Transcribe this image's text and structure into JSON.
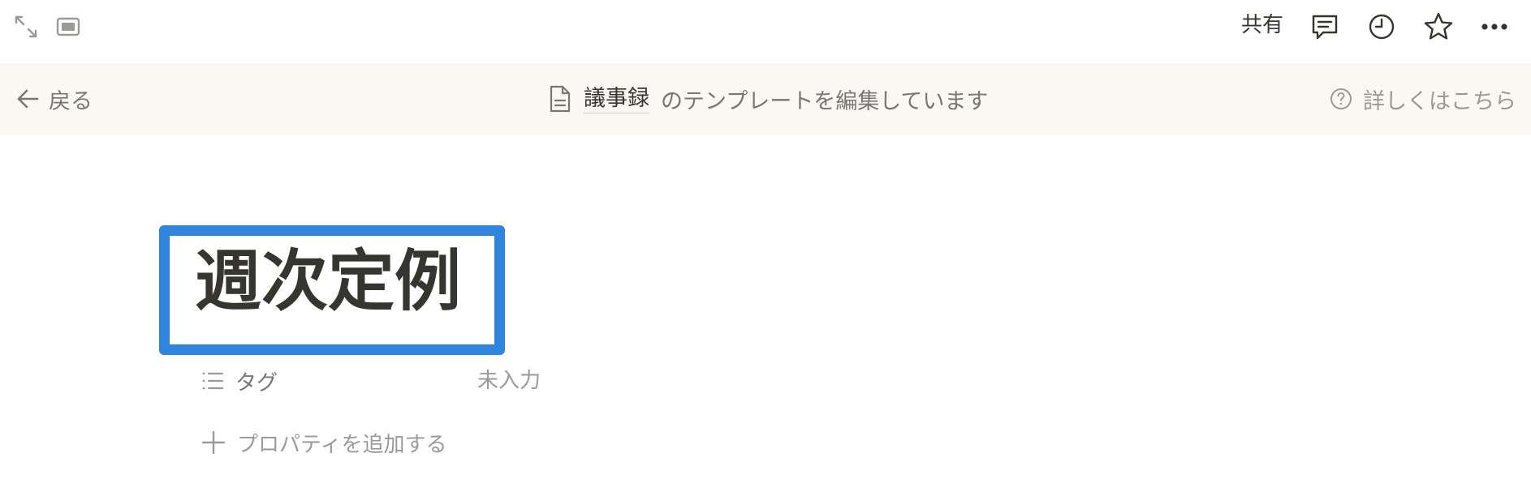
{
  "topbar": {
    "share_label": "共有",
    "icons": [
      "expand-icon",
      "peek-mode-icon",
      "comment-icon",
      "clock-icon",
      "star-icon",
      "more-icon"
    ]
  },
  "banner": {
    "back_label": "戻る",
    "template_db_name": "議事録",
    "editing_text": "のテンプレートを編集しています",
    "help_label": "詳しくはこちら"
  },
  "page": {
    "title": "週次定例",
    "properties": [
      {
        "label": "タグ",
        "value": "未入力"
      }
    ],
    "add_property_label": "プロパティを追加する"
  },
  "colors": {
    "highlight_border": "#2f84dd",
    "banner_background": "#fbf8f3",
    "text_primary": "#37352f",
    "text_secondary": "#787774",
    "text_muted": "#9b9a97"
  }
}
